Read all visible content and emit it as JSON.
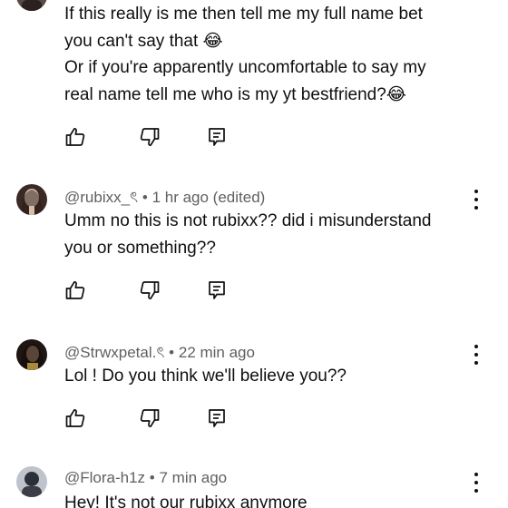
{
  "comments": [
    {
      "body": [
        "If this really is me then tell me my full name bet",
        "you can't say that 😂",
        "Or if you're apparently uncomfortable to say my",
        "real name tell me who is my yt bestfriend?😂"
      ]
    },
    {
      "handle": "@rubixx_ৎ",
      "separator": "•",
      "time": "1 hr ago (edited)",
      "body": [
        "Umm no this is not rubixx?? did i misunderstand",
        "you or something??"
      ]
    },
    {
      "handle": "@Strwxpetal.ৎ",
      "separator": "•",
      "time": "22 min ago",
      "body": [
        "Lol ! Do you think we'll believe you??"
      ]
    },
    {
      "handle": "@Flora-h1z",
      "separator": "•",
      "time": "7 min ago",
      "body": [
        "Hey! It's not our rubixx anymore"
      ]
    }
  ],
  "icons": {
    "like": "thumbs-up-icon",
    "dislike": "thumbs-down-icon",
    "reply": "reply-icon",
    "more": "more-vertical-icon"
  },
  "colors": {
    "text": "#0f0f0f",
    "meta": "#606060",
    "background": "#ffffff"
  }
}
